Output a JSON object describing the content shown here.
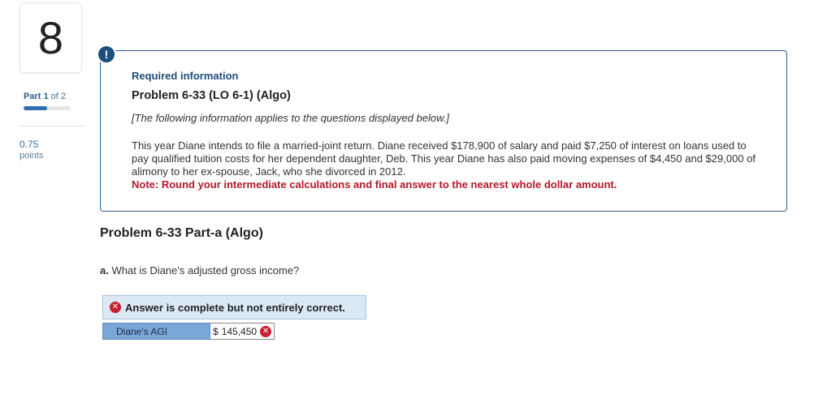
{
  "question_number": "8",
  "part": {
    "prefix": "Part",
    "current": "1",
    "of_text": "of 2",
    "progress_fraction": 0.5
  },
  "points": {
    "value": "0.75",
    "label": "points"
  },
  "info": {
    "badge": "!",
    "required_information": "Required information",
    "problem_title": "Problem 6-33 (LO 6-1) (Algo)",
    "applies_note": "[The following information applies to the questions displayed below.]",
    "body": "This year Diane intends to file a married-joint return. Diane received $178,900 of salary and paid $7,250 of interest on loans used to pay qualified tuition costs for her dependent daughter, Deb. This year Diane has also paid moving expenses of $4,450 and $29,000 of alimony to her ex-spouse, Jack, who she divorced in 2012.",
    "note": "Note: Round your intermediate calculations and final answer to the nearest whole dollar amount."
  },
  "part_a": {
    "title": "Problem 6-33 Part-a (Algo)",
    "question_prefix": "a.",
    "question_text": "What is Diane's adjusted gross income?",
    "answer_banner": "Answer is complete but not entirely correct.",
    "row_label": "Diane's AGI",
    "currency": "$",
    "value": "145,450",
    "status_icon": "incorrect-x-icon"
  },
  "colors": {
    "brand_blue": "#1f4e7c",
    "note_red": "#b3182a",
    "error_red": "#c8202f",
    "banner_bg": "#dbe9f5",
    "label_bg": "#7aa6d8"
  }
}
